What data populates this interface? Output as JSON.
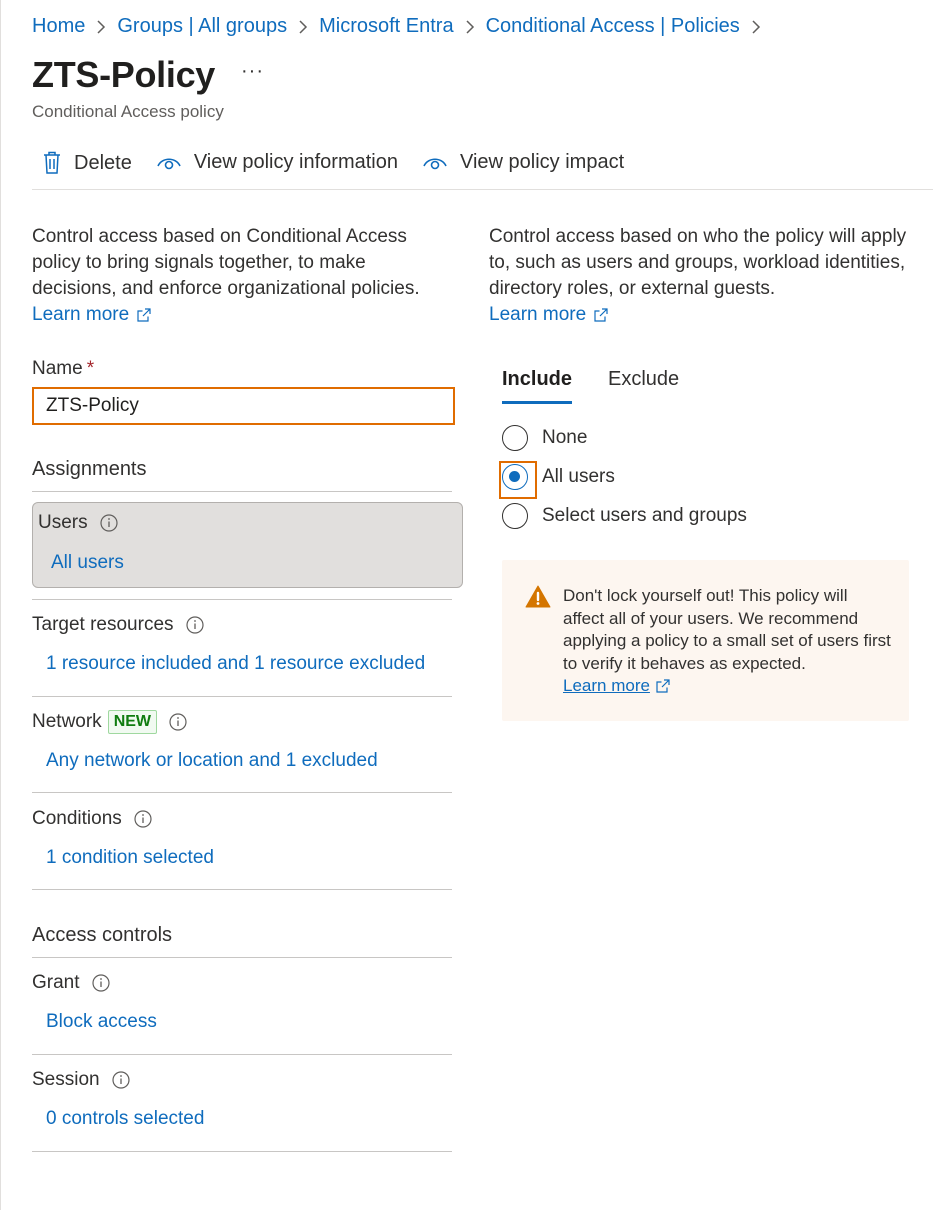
{
  "breadcrumb": [
    "Home",
    "Groups | All groups",
    "Microsoft Entra",
    "Conditional Access | Policies"
  ],
  "page": {
    "title": "ZTS-Policy",
    "more_label": "···",
    "subtitle": "Conditional Access policy"
  },
  "toolbar": {
    "delete_label": "Delete",
    "view_info_label": "View policy information",
    "view_impact_label": "View policy impact"
  },
  "left_desc": {
    "text": "Control access based on Conditional Access policy to bring signals together, to make decisions, and enforce organizational policies.",
    "learn_more": "Learn more"
  },
  "right_desc": {
    "text": "Control access based on who the policy will apply to, such as users and groups, workload identities, directory roles, or external guests.",
    "learn_more": "Learn more"
  },
  "name_field": {
    "label": "Name",
    "required_mark": "*",
    "value": "ZTS-Policy"
  },
  "assignments": {
    "heading": "Assignments",
    "users": {
      "label": "Users",
      "value": "All users"
    },
    "target_resources": {
      "label": "Target resources",
      "value": "1 resource included and 1 resource excluded"
    },
    "network": {
      "label": "Network",
      "badge": "NEW",
      "value": "Any network or location and 1 excluded"
    },
    "conditions": {
      "label": "Conditions",
      "value": "1 condition selected"
    }
  },
  "access_controls": {
    "heading": "Access controls",
    "grant": {
      "label": "Grant",
      "value": "Block access"
    },
    "session": {
      "label": "Session",
      "value": "0 controls selected"
    }
  },
  "tabs": [
    {
      "label": "Include",
      "active": true
    },
    {
      "label": "Exclude",
      "active": false
    }
  ],
  "radio_options": [
    {
      "label": "None",
      "checked": false
    },
    {
      "label": "All users",
      "checked": true
    },
    {
      "label": "Select users and groups",
      "checked": false
    }
  ],
  "warning": {
    "text": "Don't lock yourself out! This policy will affect all of your users. We recommend applying a policy to a small set of users first to verify it behaves as expected.",
    "learn_more": "Learn more"
  },
  "colors": {
    "link": "#0f6cbd",
    "highlight": "#e06c00",
    "warning_bg": "#fdf6f0",
    "warning_icon": "#d47500"
  }
}
